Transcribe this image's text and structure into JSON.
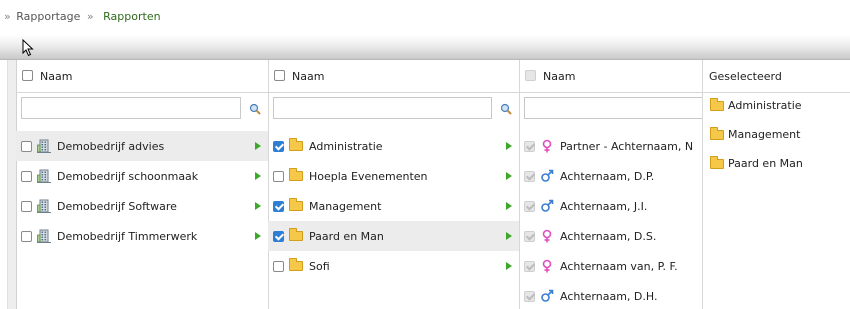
{
  "breadcrumb": {
    "separator": "»",
    "items": [
      "Rapportage",
      "Rapporten"
    ]
  },
  "columns": {
    "companies": {
      "header": "Naam",
      "items": [
        {
          "label": "Demobedrijf advies",
          "checked": false,
          "highlighted": true
        },
        {
          "label": "Demobedrijf schoonmaak",
          "checked": false,
          "highlighted": false
        },
        {
          "label": "Demobedrijf Software",
          "checked": false,
          "highlighted": false
        },
        {
          "label": "Demobedrijf Timmerwerk",
          "checked": false,
          "highlighted": false
        }
      ]
    },
    "departments": {
      "header": "Naam",
      "items": [
        {
          "label": "Administratie",
          "checked": true,
          "highlighted": false
        },
        {
          "label": "Hoepla Evenementen",
          "checked": false,
          "highlighted": false
        },
        {
          "label": "Management",
          "checked": true,
          "highlighted": false
        },
        {
          "label": "Paard en Man",
          "checked": true,
          "highlighted": true
        },
        {
          "label": "Sofi",
          "checked": false,
          "highlighted": false
        }
      ]
    },
    "persons": {
      "header": "Naam",
      "items": [
        {
          "label": "Partner - Achternaam, N",
          "gender": "female"
        },
        {
          "label": "Achternaam, D.P.",
          "gender": "male"
        },
        {
          "label": "Achternaam, J.I.",
          "gender": "male"
        },
        {
          "label": "Achternaam, D.S.",
          "gender": "female"
        },
        {
          "label": "Achternaam van, P. F.",
          "gender": "female"
        },
        {
          "label": "Achternaam, D.H.",
          "gender": "male"
        }
      ]
    },
    "selected": {
      "header": "Geselecteerd",
      "items": [
        "Administratie",
        "Management",
        "Paard en Man"
      ]
    }
  },
  "colors": {
    "accent_green": "#3ea82a",
    "breadcrumb_active": "#2f6b1c",
    "checkbox_blue": "#2e7ed6",
    "female_icon": "#e04fc0",
    "male_icon": "#3a7fd0"
  },
  "icons": {
    "search": "magnifier-icon",
    "company": "building-icon",
    "department": "folder-icon",
    "female": "female-person-icon",
    "male": "male-person-icon",
    "expand": "arrow-right-icon"
  }
}
